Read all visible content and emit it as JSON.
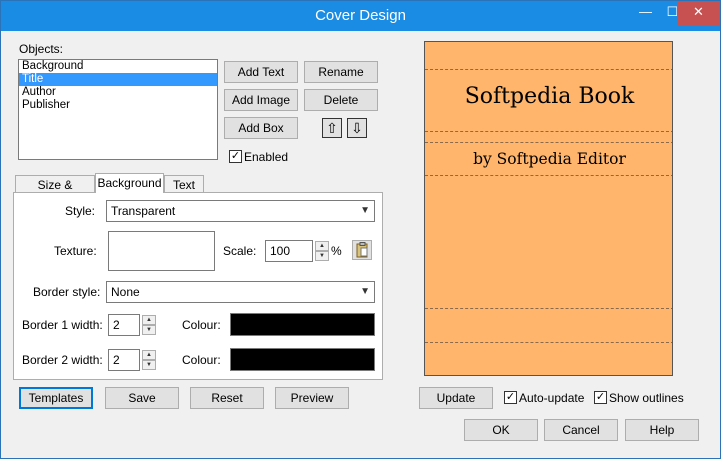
{
  "window": {
    "title": "Cover Design",
    "minimize_glyph": "—",
    "maximize_glyph": "☐",
    "close_glyph": "✕"
  },
  "objects": {
    "label": "Objects:",
    "items": [
      "Background",
      "Title",
      "Author",
      "Publisher"
    ],
    "selected_index": 1
  },
  "buttons": {
    "add_text": "Add Text",
    "rename": "Rename",
    "add_image": "Add Image",
    "delete": "Delete",
    "add_box": "Add Box",
    "move_up_glyph": "⇧",
    "move_down_glyph": "⇩"
  },
  "enabled": {
    "label": "Enabled",
    "checked": true,
    "glyph": "✓"
  },
  "tabs": [
    "Size & Position",
    "Background",
    "Text"
  ],
  "active_tab": "Background",
  "background_tab": {
    "style_label": "Style:",
    "style_value": "Transparent",
    "texture_label": "Texture:",
    "scale_label": "Scale:",
    "scale_value": "100",
    "scale_unit": "%",
    "border_style_label": "Border style:",
    "border_style_value": "None",
    "border1_label": "Border 1 width:",
    "border1_value": "2",
    "border2_label": "Border 2 width:",
    "border2_value": "2",
    "colour_label": "Colour:",
    "colour1": "#000000",
    "colour2": "#000000"
  },
  "preview": {
    "background_color": "#ffb56b",
    "title_text": "Softpedia Book",
    "author_text": "by Softpedia Editor"
  },
  "bottom_buttons": {
    "templates": "Templates",
    "save": "Save",
    "reset": "Reset",
    "preview": "Preview",
    "update": "Update",
    "ok": "OK",
    "cancel": "Cancel",
    "help": "Help"
  },
  "auto_update": {
    "label": "Auto-update",
    "checked": true
  },
  "show_outlines": {
    "label": "Show outlines",
    "checked": true
  },
  "icons": {
    "dropdown_arrow": "▼",
    "spin_up": "▲",
    "spin_down": "▼",
    "paste": "clipboard-icon"
  }
}
